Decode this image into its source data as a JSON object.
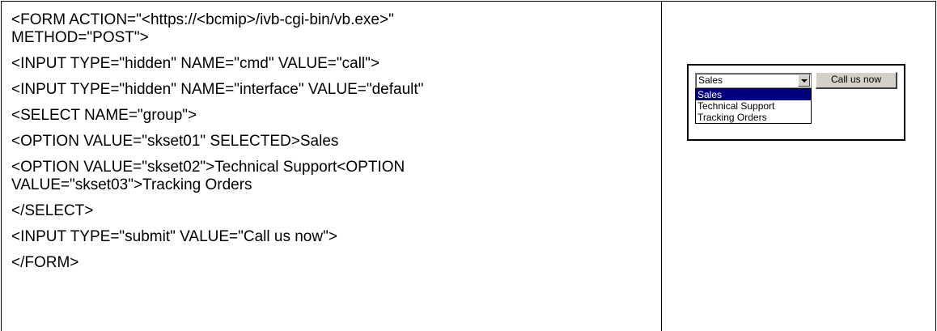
{
  "code_lines": [
    "<FORM ACTION=\"<https://<bcmip>/ivb-cgi-bin/vb.exe>\"\nMETHOD=\"POST\">",
    "<INPUT TYPE=\"hidden\" NAME=\"cmd\" VALUE=\"call\">",
    "<INPUT TYPE=\"hidden\" NAME=\"interface\" VALUE=\"default\"",
    "<SELECT NAME=\"group\">",
    "<OPTION VALUE=\"skset01\" SELECTED>Sales",
    "<OPTION VALUE=\"skset02\">Technical Support<OPTION\nVALUE=\"skset03\">Tracking Orders",
    "</SELECT>",
    "<INPUT TYPE=\"submit\" VALUE=\"Call us now\">",
    "</FORM>"
  ],
  "preview": {
    "select_value": "Sales",
    "submit_label": "Call us now",
    "options": [
      "Sales",
      "Technical Support",
      "Tracking Orders"
    ],
    "highlight_color": "#000080"
  }
}
